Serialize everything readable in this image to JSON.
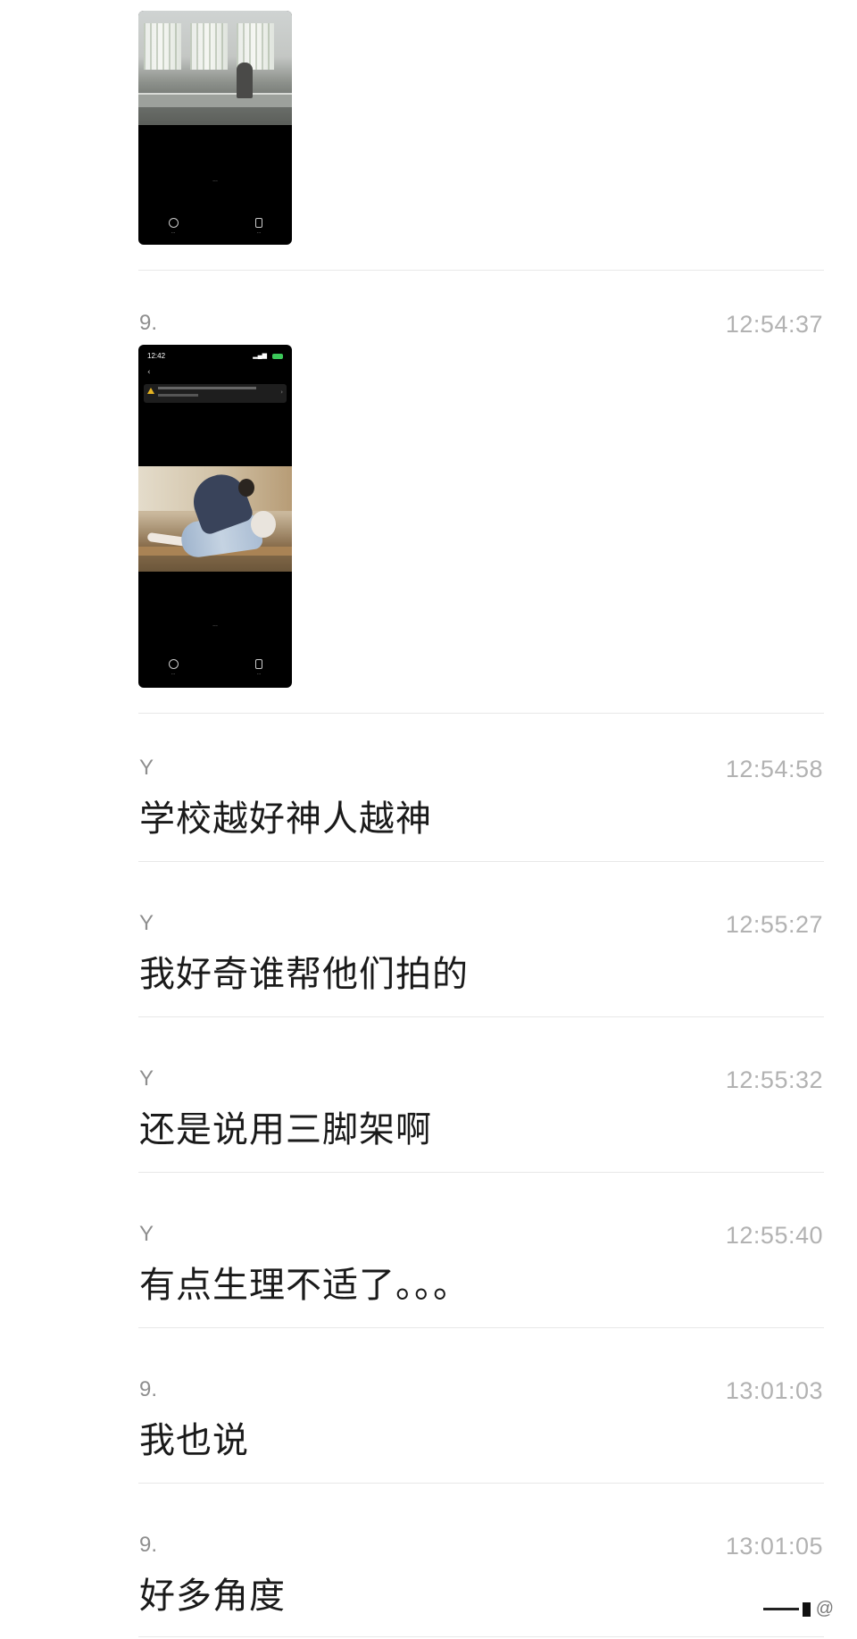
{
  "thumbnail_1": {
    "caption": "···",
    "left_button": "···",
    "right_button": "···"
  },
  "thumbnail_2": {
    "status_time": "12:42",
    "caption": "···",
    "left_button": "···",
    "right_button": "···"
  },
  "messages": [
    {
      "sender": "9.",
      "time": "12:54:37",
      "text": ""
    },
    {
      "sender": "Y",
      "time": "12:54:58",
      "text": "学校越好神人越神"
    },
    {
      "sender": "Y",
      "time": "12:55:27",
      "text": "我好奇谁帮他们拍的"
    },
    {
      "sender": "Y",
      "time": "12:55:32",
      "text": "还是说用三脚架啊"
    },
    {
      "sender": "Y",
      "time": "12:55:40",
      "text": "有点生理不适了。。。"
    },
    {
      "sender": "9.",
      "time": "13:01:03",
      "text": "我也说"
    },
    {
      "sender": "9.",
      "time": "13:01:05",
      "text": "好多角度"
    }
  ],
  "watermark": "@"
}
